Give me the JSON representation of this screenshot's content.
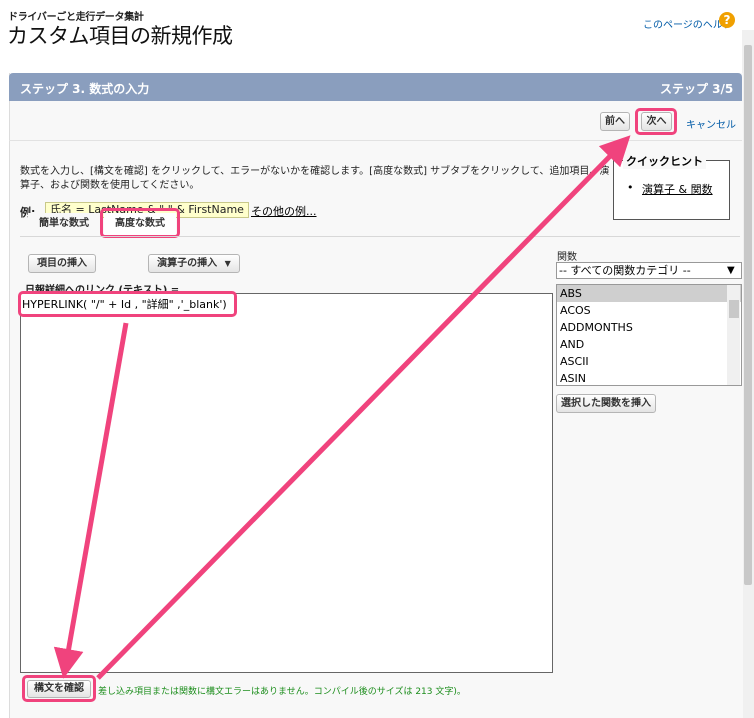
{
  "page": {
    "breadcrumb": "ドライバーごと走行データ集計",
    "title": "カスタム項目の新規作成",
    "help_link": "このページのヘルプ",
    "help_icon": "?"
  },
  "step": {
    "title": "ステップ 3. 数式の入力",
    "count": "ステップ 3/5"
  },
  "toolbar": {
    "prev_label": "前へ",
    "next_label": "次へ",
    "cancel_label": "キャンセル"
  },
  "instructions": "数式を入力し、[構文を確認] をクリックして、エラーがないかを確認します。[高度な数式] サブタブをクリックして、追加項目、演算子、および関数を使用してください。",
  "example": {
    "label": "例:",
    "value": "氏名 = LastName & \" \" & FirstName",
    "more_link": "その他の例..."
  },
  "quick_hint": {
    "legend": "クイックヒント",
    "item": "演算子 & 関数"
  },
  "tabs": [
    {
      "label": "簡単な数式"
    },
    {
      "label": "高度な数式"
    }
  ],
  "buttons": {
    "insert_field": "項目の挿入",
    "insert_operator": "演算子の挿入",
    "insert_operator_arrow": "▼",
    "insert_function": "選択した関数を挿入",
    "check_syntax": "構文を確認"
  },
  "functions": {
    "label": "関数",
    "category": "-- すべての関数カテゴリ --",
    "category_arrow": "▼",
    "list": [
      "ABS",
      "ACOS",
      "ADDMONTHS",
      "AND",
      "ASCII",
      "ASIN"
    ],
    "selected": "ABS"
  },
  "formula": {
    "field_label": "日報詳細へのリンク (テキスト) =",
    "text": "HYPERLINK( \"/\" + Id , \"詳細\" ,'_blank')"
  },
  "status": "差し込み項目または関数に構文エラーはありません。コンパイル後のサイズは 213 文字)。",
  "colors": {
    "header_bg": "#8a9ebe",
    "highlight": "#f0437d",
    "status_text": "#1d8e1d",
    "link": "#015ba7"
  }
}
